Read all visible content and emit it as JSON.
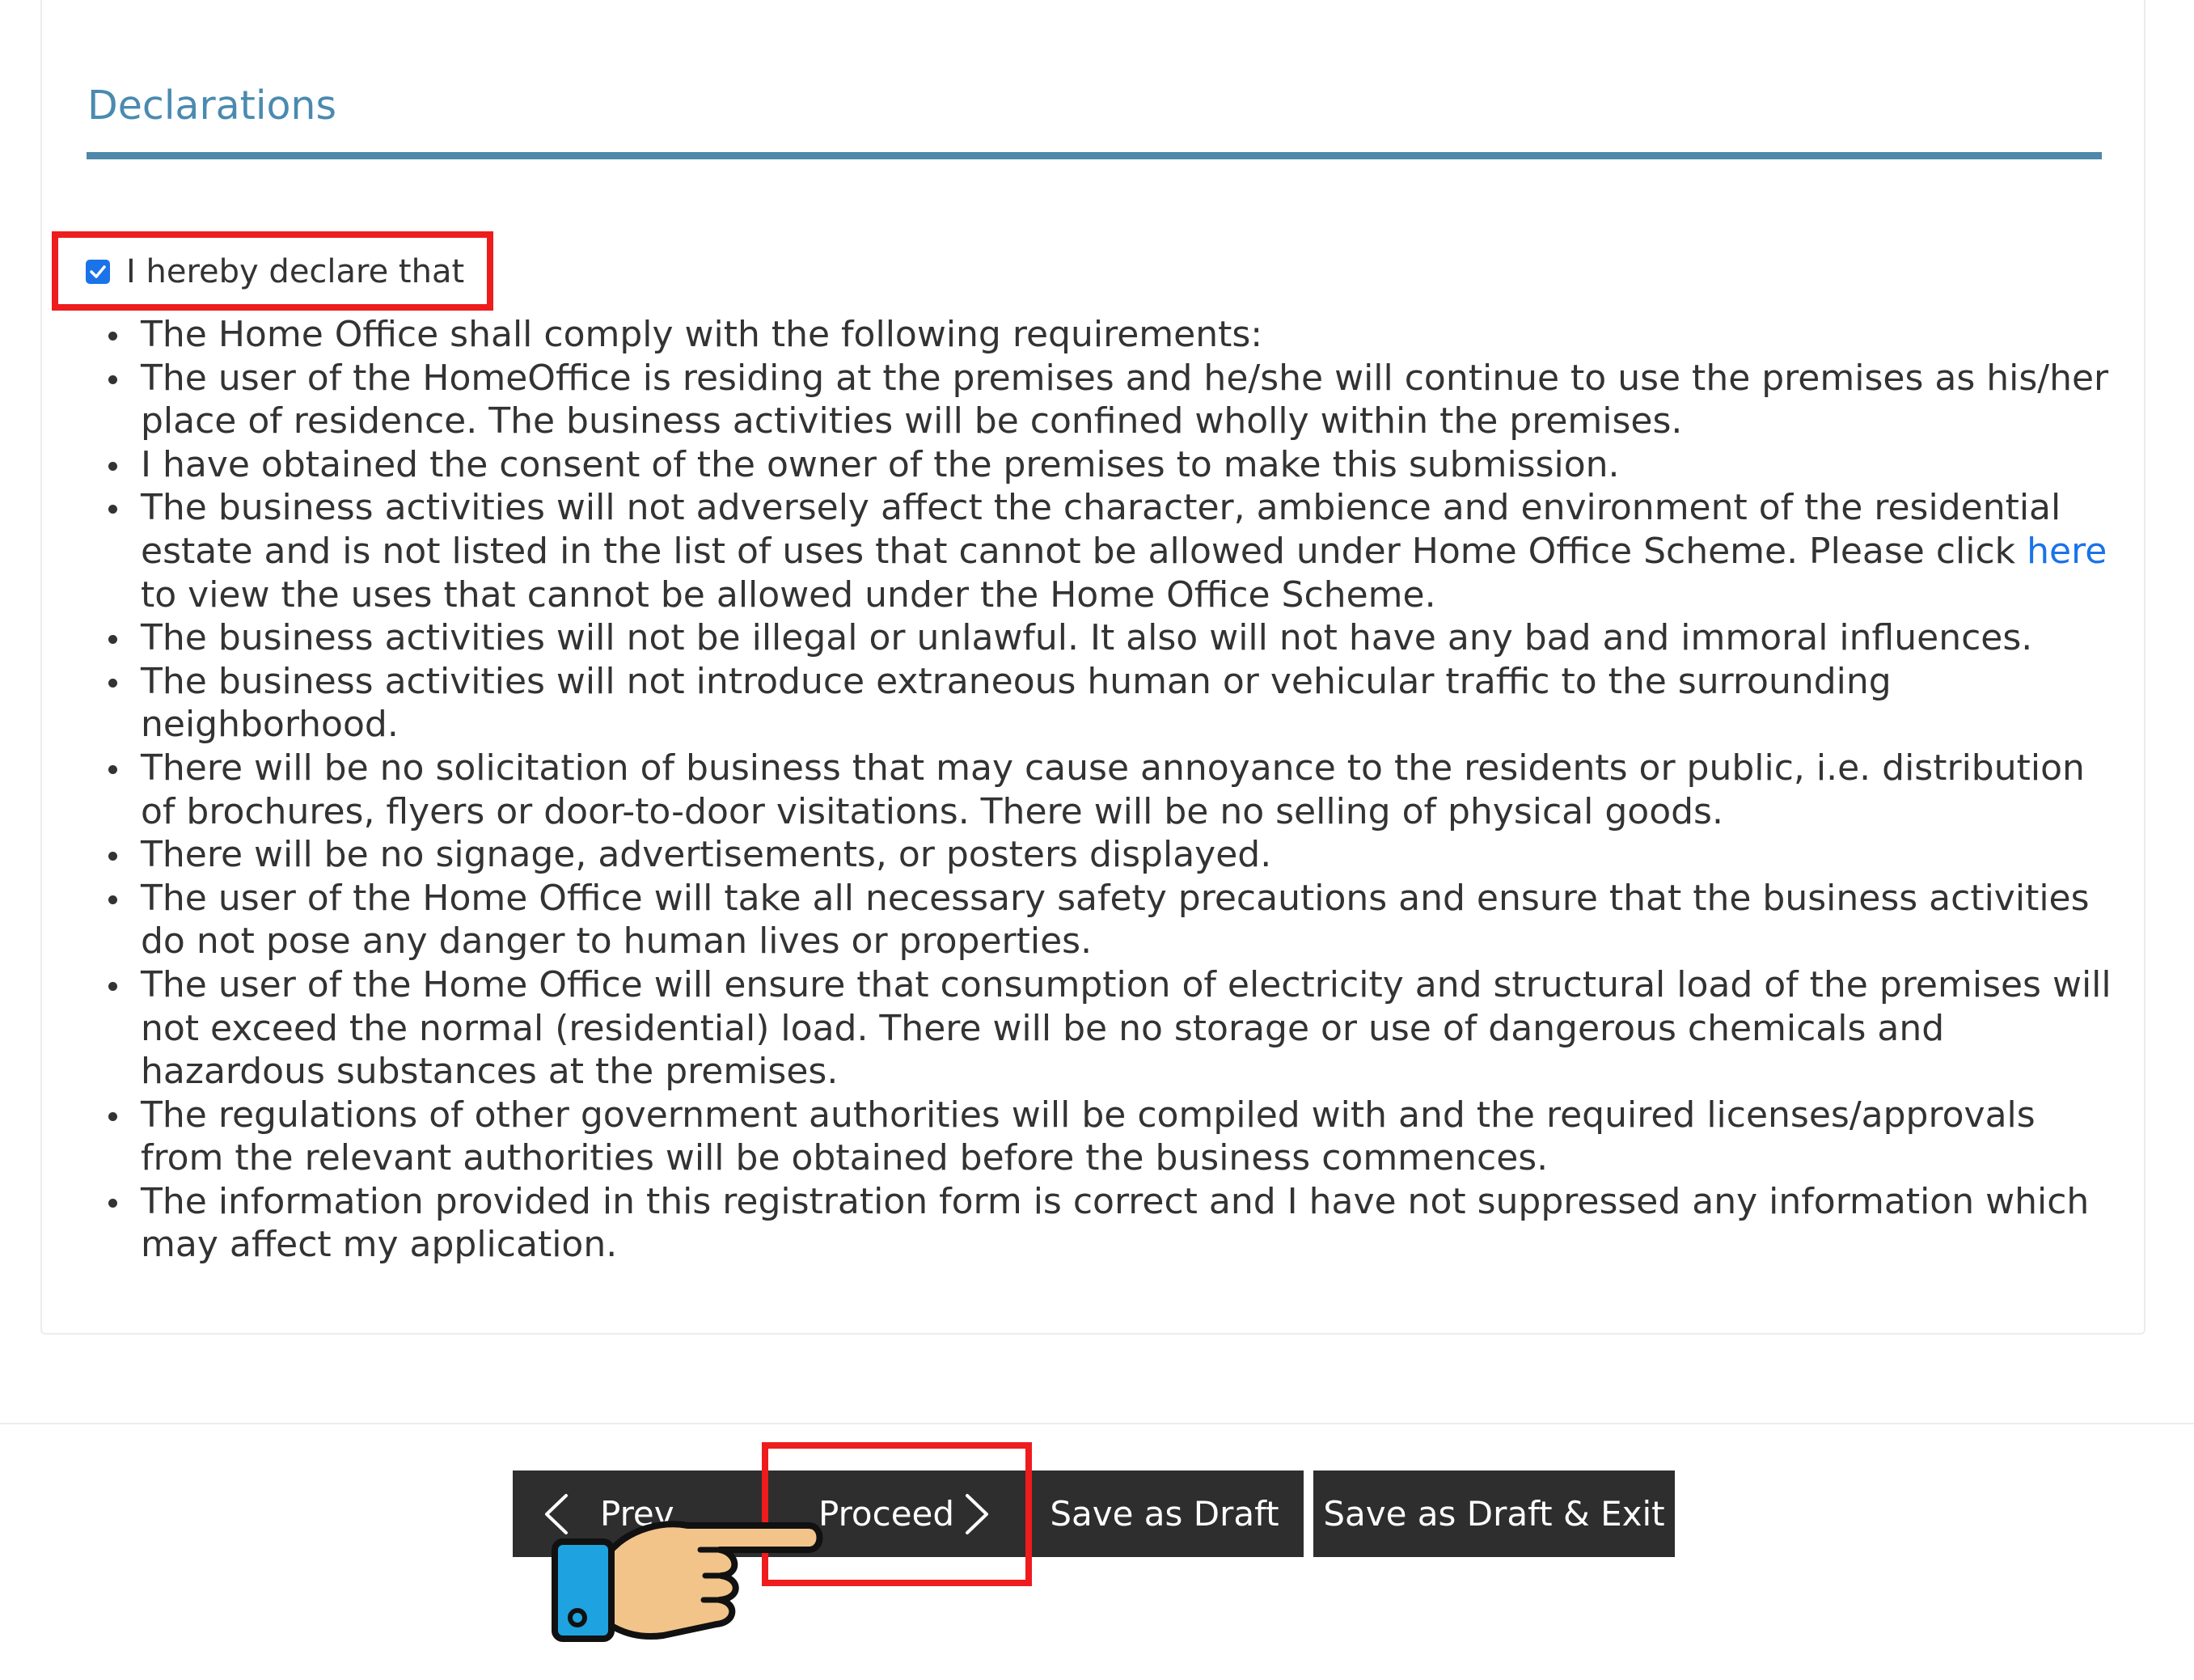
{
  "section": {
    "title": "Declarations"
  },
  "declaration": {
    "checked": true,
    "label": "I hereby declare that",
    "items": [
      {
        "text": "The Home Office shall comply with the following requirements:"
      },
      {
        "text": "The user of the HomeOffice is residing at the premises and he/she will continue to use the premises as his/her place of residence. The business activities will be confined wholly within the premises."
      },
      {
        "text": "I have obtained the consent of the owner of the premises to make this submission."
      },
      {
        "text_before": "The business activities will not adversely affect the character, ambience and environment of the residential estate and is not listed in the list of uses that cannot be allowed under Home Office Scheme. Please click ",
        "link": "here",
        "text_after": " to view the uses that cannot be allowed under the Home Office Scheme."
      },
      {
        "text": "The business activities will not be illegal or unlawful. It also will not have any bad and immoral influences."
      },
      {
        "text": "The business activities will not introduce extraneous human or vehicular traffic to the surrounding neighborhood."
      },
      {
        "text": "There will be no solicitation of business that may cause annoyance to the residents or public, i.e. distribution of brochures, flyers or door-to-door visitations. There will be no selling of physical goods."
      },
      {
        "text": "There will be no signage, advertisements, or posters displayed."
      },
      {
        "text": "The user of the Home Office will take all necessary safety precautions and ensure that the business activities do not pose any danger to human lives or properties."
      },
      {
        "text": "The user of the Home Office will ensure that consumption of electricity and structural load of the premises will not exceed the normal (residential) load. There will be no storage or use of dangerous chemicals and hazardous substances at the premises."
      },
      {
        "text": "The regulations of other government authorities will be compiled with and the required licenses/approvals from the relevant authorities will be obtained before the business commences."
      },
      {
        "text": "The information provided in this registration form is correct and I have not suppressed any information which may affect my application."
      }
    ]
  },
  "buttons": {
    "previous": "Prev",
    "proceed": "Proceed",
    "save_draft": "Save as Draft",
    "save_draft_exit": "Save as Draft & Exit"
  },
  "colors": {
    "accent": "#4a8ab0",
    "highlight": "#ee1c1c",
    "button_bg": "#2e2e2e",
    "link": "#1a73e8"
  },
  "icons": [
    "checkbox-checked-icon",
    "chevron-left-icon",
    "chevron-right-icon",
    "pointing-hand-icon"
  ]
}
